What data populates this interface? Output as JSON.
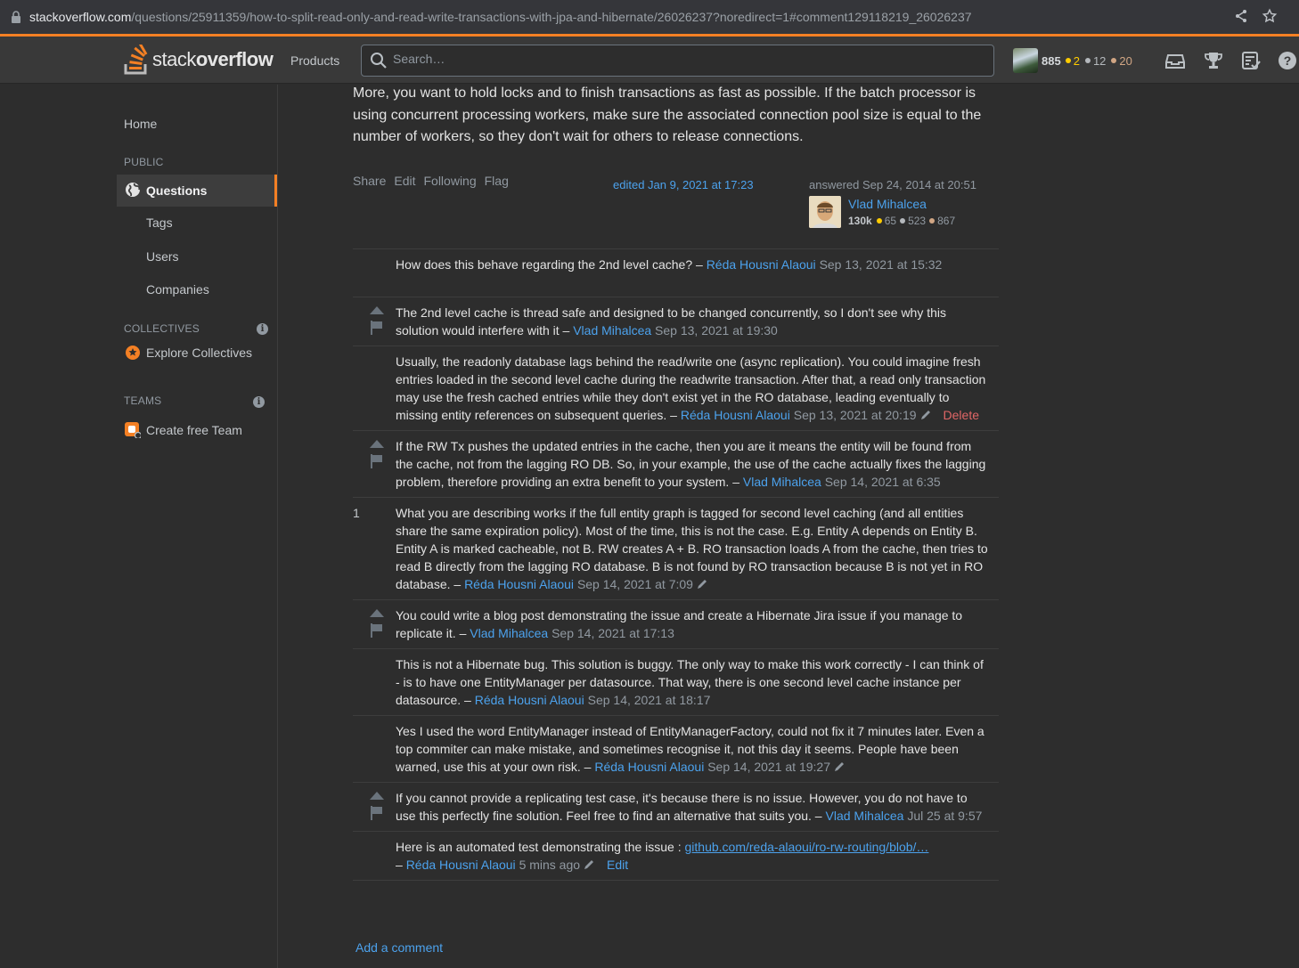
{
  "browser": {
    "url_host": "stackoverflow.com",
    "url_path": "/questions/25911359/how-to-split-read-only-and-read-write-transactions-with-jpa-and-hibernate/26026237?noredirect=1#comment129118219_26026237"
  },
  "topbar": {
    "logo_light": "stack",
    "logo_bold": "overflow",
    "products": "Products",
    "search_placeholder": "Search…",
    "reputation": "885",
    "gold": "2",
    "silver": "12",
    "bronze": "20"
  },
  "sidebar": {
    "home": "Home",
    "public_heading": "PUBLIC",
    "questions": "Questions",
    "tags": "Tags",
    "users": "Users",
    "companies": "Companies",
    "collectives_heading": "COLLECTIVES",
    "explore_collectives": "Explore Collectives",
    "teams_heading": "TEAMS",
    "create_team": "Create free Team"
  },
  "answer": {
    "body_tail": "More, you want to hold locks and to finish transactions as fast as possible. If the batch processor is using concurrent processing workers, make sure the associated connection pool size is equal to the number of workers, so they don't wait for others to release connections.",
    "menu": [
      "Share",
      "Edit",
      "Following",
      "Flag"
    ],
    "edited": "edited Jan 9, 2021 at 17:23",
    "answered": "answered Sep 24, 2014 at 20:51",
    "author": "Vlad Mihalcea",
    "author_rep": "130k",
    "author_gold": "65",
    "author_silver": "523",
    "author_bronze": "867"
  },
  "comments": [
    {
      "text": "How does this behave regarding the 2nd level cache? –",
      "user": "Réda Housni Alaoui",
      "date": "Sep 13, 2021 at 15:32"
    },
    {
      "text": "The 2nd level cache is thread safe and designed to be changed concurrently, so I don't see why this solution would interfere with it –",
      "user": "Vlad Mihalcea",
      "date": "Sep 13, 2021 at 19:30"
    },
    {
      "text": "Usually, the readonly database lags behind the read/write one (async replication). You could imagine fresh entries loaded in the second level cache during the readwrite transaction. After that, a read only transaction may use the fresh cached entries while they don't exist yet in the RO database, leading eventually to missing entity references on subsequent queries. –",
      "user": "Réda Housni Alaoui",
      "date": "Sep 13, 2021 at 20:19",
      "delete": "Delete"
    },
    {
      "text": "If the RW Tx pushes the updated entries in the cache, then you are it means the entity will be found from the cache, not from the lagging RO DB. So, in your example, the use of the cache actually fixes the lagging problem, therefore providing an extra benefit to your system. –",
      "user": "Vlad Mihalcea",
      "date": "Sep 14, 2021 at 6:35"
    },
    {
      "score": "1",
      "text": "What you are describing works if the full entity graph is tagged for second level caching (and all entities share the same expiration policy). Most of the time, this is not the case. E.g. Entity A depends on Entity B. Entity A is marked cacheable, not B. RW creates A + B. RO transaction loads A from the cache, then tries to read B directly from the lagging RO database. B is not found by RO transaction because B is not yet in RO database. –",
      "user": "Réda Housni Alaoui",
      "date": "Sep 14, 2021 at 7:09"
    },
    {
      "text": "You could write a blog post demonstrating the issue and create a Hibernate Jira issue if you manage to replicate it. –",
      "user": "Vlad Mihalcea",
      "date": "Sep 14, 2021 at 17:13"
    },
    {
      "text": "This is not a Hibernate bug. This solution is buggy. The only way to make this work correctly - I can think of - is to have one EntityManager per datasource. That way, there is one second level cache instance per datasource. –",
      "user": "Réda Housni Alaoui",
      "date": "Sep 14, 2021 at 18:17"
    },
    {
      "text": "Yes I used the word EntityManager instead of EntityManagerFactory, could not fix it 7 minutes later. Even a top commiter can make mistake, and sometimes recognise it, not this day it seems. People have been warned, use this at your own risk. –",
      "user": "Réda Housni Alaoui",
      "date": "Sep 14, 2021 at 19:27"
    },
    {
      "text": "If you cannot provide a replicating test case, it's because there is no issue. However, you do not have to use this perfectly fine solution. Feel free to find an alternative that suits you. –",
      "user": "Vlad Mihalcea",
      "date": "Jul 25 at 9:57"
    },
    {
      "text": "Here is an automated test demonstrating the issue :",
      "link": "github.com/reda-alaoui/ro-rw-routing/blob/…",
      "prefix2": "–",
      "user": "Réda Housni Alaoui",
      "date": "5 mins ago",
      "edit": "Edit"
    }
  ],
  "add_comment": "Add a comment",
  "colors": {
    "accent": "#f48024",
    "link": "#4ca2ed",
    "background": "#2d2d2d"
  }
}
